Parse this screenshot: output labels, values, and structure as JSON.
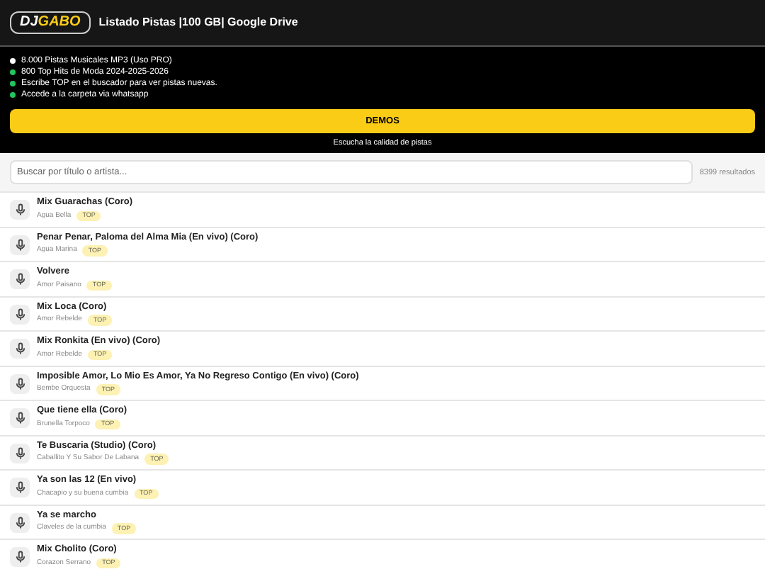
{
  "header": {
    "logo": {
      "part1": "DJ",
      "part2": "GABO"
    },
    "title": "Listado Pistas |100 GB| Google Drive"
  },
  "features": [
    {
      "text": "8.000 Pistas Musicales MP3 (Uso PRO)",
      "color": "#ffffff"
    },
    {
      "text": "800 Top Hits de Moda 2024-2025-2026",
      "color": "#22c55e"
    },
    {
      "text": "Escribe TOP en el buscador para ver pistas nuevas.",
      "color": "#22c55e"
    },
    {
      "text": "Accede a la carpeta via whatsapp",
      "color": "#22c55e"
    }
  ],
  "demos_button": "DEMOS",
  "demos_caption": "Escucha la calidad de pistas",
  "search": {
    "placeholder": "Buscar por título o artista...",
    "results": "8399 resultados"
  },
  "tracks": [
    {
      "title": "Mix Guarachas (Coro)",
      "artist": "Agua Bella",
      "badge": "TOP"
    },
    {
      "title": "Penar Penar, Paloma del Alma Mia (En vivo) (Coro)",
      "artist": "Agua Marina",
      "badge": "TOP"
    },
    {
      "title": "Volvere",
      "artist": "Amor Paisano",
      "badge": "TOP"
    },
    {
      "title": "Mix Loca (Coro)",
      "artist": "Amor Rebelde",
      "badge": "TOP"
    },
    {
      "title": "Mix Ronkita (En vivo) (Coro)",
      "artist": "Amor Rebelde",
      "badge": "TOP"
    },
    {
      "title": "Imposible Amor, Lo Mio Es Amor, Ya No Regreso Contigo (En vivo) (Coro)",
      "artist": "Bembe Orquesta",
      "badge": "TOP"
    },
    {
      "title": "Que tiene ella (Coro)",
      "artist": "Brunella Torpoco",
      "badge": "TOP"
    },
    {
      "title": "Te Buscaria (Studio) (Coro)",
      "artist": "Caballito Y Su Sabor De Labana",
      "badge": "TOP"
    },
    {
      "title": "Ya son las 12 (En vivo)",
      "artist": "Chacapio y su buena cumbia",
      "badge": "TOP"
    },
    {
      "title": "Ya se marcho",
      "artist": "Claveles de la cumbia",
      "badge": "TOP"
    },
    {
      "title": "Mix Cholito (Coro)",
      "artist": "Corazon Serrano",
      "badge": "TOP"
    }
  ]
}
